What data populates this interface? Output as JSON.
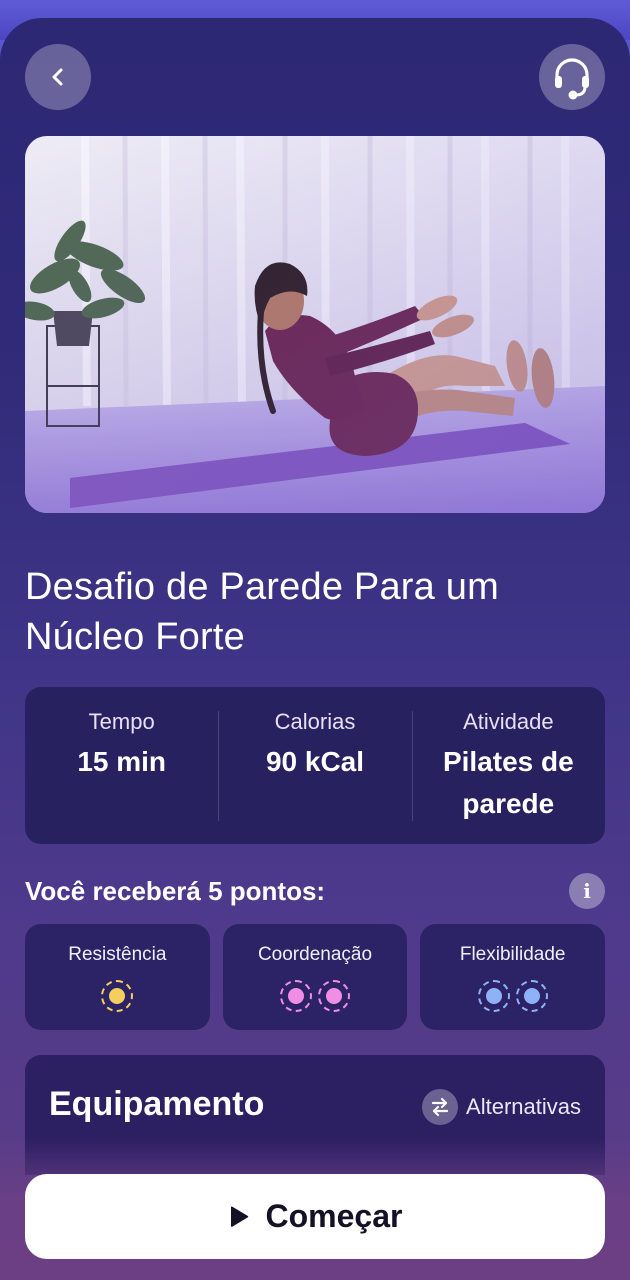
{
  "header": {
    "back_icon": "chevron-left-icon",
    "support_icon": "headset-icon"
  },
  "workout": {
    "title": "Desafio de Parede Para um Núcleo Forte",
    "stats": [
      {
        "label": "Tempo",
        "value": "15 min"
      },
      {
        "label": "Calorias",
        "value": "90 kCal"
      },
      {
        "label": "Atividade",
        "value": "Pilates de parede"
      }
    ]
  },
  "points": {
    "heading": "Você receberá 5 pontos:",
    "info_icon": "info-icon",
    "info_glyph": "i",
    "skills": [
      {
        "label": "Resistência",
        "count": 1,
        "color": "#f6cd5f"
      },
      {
        "label": "Coordenação",
        "count": 2,
        "color": "#f08ee6"
      },
      {
        "label": "Flexibilidade",
        "count": 2,
        "color": "#8fb2f7"
      }
    ]
  },
  "equipment": {
    "title": "Equipamento",
    "alternatives_label": "Alternativas",
    "alternatives_icon": "swap-icon"
  },
  "cta": {
    "label": "Começar",
    "icon": "play-icon"
  },
  "colors": {
    "background_top": "#2d2874",
    "background_bottom": "#5e3d86",
    "card": "#272160",
    "cta_background": "#ffffff"
  }
}
